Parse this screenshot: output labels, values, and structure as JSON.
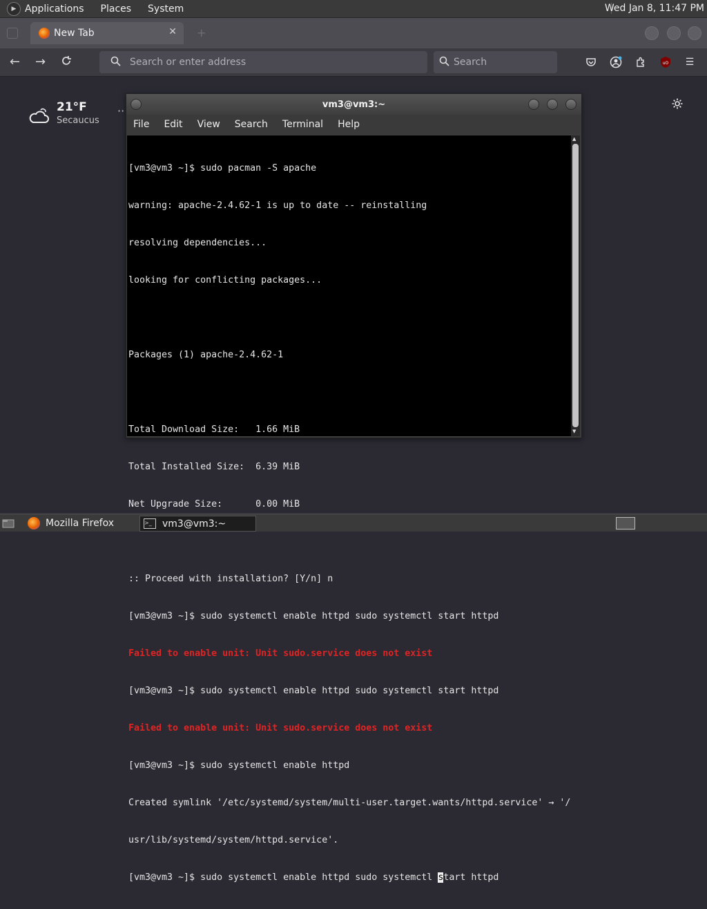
{
  "top_panel": {
    "menus": [
      "Applications",
      "Places",
      "System"
    ],
    "clock": "Wed Jan  8, 11:47 PM"
  },
  "browser": {
    "tab_title": "New Tab",
    "url_placeholder": "Search or enter address",
    "search_placeholder": "Search"
  },
  "weather": {
    "temperature": "21°F",
    "location": "Secaucus"
  },
  "terminal": {
    "title": "vm3@vm3:~",
    "menu": [
      "File",
      "Edit",
      "View",
      "Search",
      "Terminal",
      "Help"
    ],
    "lines": [
      {
        "text": "[vm3@vm3 ~]$ sudo pacman -S apache",
        "error": false
      },
      {
        "text": "warning: apache-2.4.62-1 is up to date -- reinstalling",
        "error": false
      },
      {
        "text": "resolving dependencies...",
        "error": false
      },
      {
        "text": "looking for conflicting packages...",
        "error": false
      },
      {
        "text": "",
        "error": false
      },
      {
        "text": "Packages (1) apache-2.4.62-1",
        "error": false
      },
      {
        "text": "",
        "error": false
      },
      {
        "text": "Total Download Size:   1.66 MiB",
        "error": false
      },
      {
        "text": "Total Installed Size:  6.39 MiB",
        "error": false
      },
      {
        "text": "Net Upgrade Size:      0.00 MiB",
        "error": false
      },
      {
        "text": "",
        "error": false
      },
      {
        "text": ":: Proceed with installation? [Y/n] n",
        "error": false
      },
      {
        "text": "[vm3@vm3 ~]$ sudo systemctl enable httpd sudo systemctl start httpd",
        "error": false
      },
      {
        "text": "Failed to enable unit: Unit sudo.service does not exist",
        "error": true
      },
      {
        "text": "[vm3@vm3 ~]$ sudo systemctl enable httpd sudo systemctl start httpd",
        "error": false
      },
      {
        "text": "Failed to enable unit: Unit sudo.service does not exist",
        "error": true
      },
      {
        "text": "[vm3@vm3 ~]$ sudo systemctl enable httpd",
        "error": false
      },
      {
        "text": "Created symlink '/etc/systemd/system/multi-user.target.wants/httpd.service' → '/",
        "error": false
      },
      {
        "text": "usr/lib/systemd/system/httpd.service'.",
        "error": false
      }
    ],
    "prompt_before_cursor": "[vm3@vm3 ~]$ sudo systemctl enable httpd sudo systemctl ",
    "cursor_char": "s",
    "prompt_after_cursor": "tart httpd"
  },
  "taskbar": {
    "items": [
      "Mozilla Firefox",
      "vm3@vm3:~"
    ]
  }
}
